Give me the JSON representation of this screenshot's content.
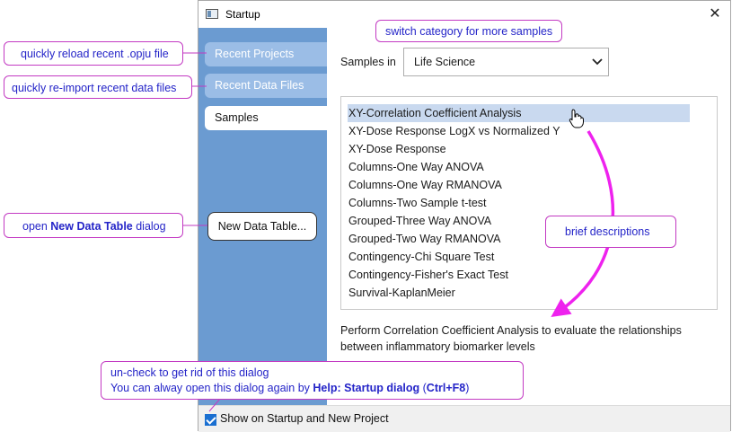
{
  "window": {
    "title": "Startup",
    "close_glyph": "✕"
  },
  "sidebar": {
    "items": [
      {
        "label": "Recent Projects"
      },
      {
        "label": "Recent Data Files"
      },
      {
        "label": "Samples"
      }
    ],
    "new_table_button": "New Data Table..."
  },
  "main": {
    "samples_label": "Samples in",
    "category_selected": "Life Science",
    "list": [
      "XY-Correlation Coefficient Analysis",
      "XY-Dose Response LogX vs Normalized Y",
      "XY-Dose Response",
      "Columns-One Way ANOVA",
      "Columns-One Way RMANOVA",
      "Columns-Two Sample t-test",
      "Grouped-Three Way ANOVA",
      "Grouped-Two Way RMANOVA",
      "Contingency-Chi Square Test",
      "Contingency-Fisher's Exact Test",
      "Survival-KaplanMeier"
    ],
    "description_line1": "Perform Correlation Coefficient Analysis to evaluate the relationships",
    "description_line2": "between inflammatory biomarker levels"
  },
  "footer": {
    "checkbox_label": "Show on Startup and New Project",
    "checked": true
  },
  "callouts": {
    "switch_category": "switch category for more samples",
    "reload_recent": "quickly reload recent .opju file",
    "reimport": "quickly re-import recent data files",
    "open_prefix": "open ",
    "open_bold": "New Data Table",
    "open_suffix": " dialog",
    "brief": "brief descriptions",
    "uncheck_line1": "un-check to get rid of this dialog",
    "uncheck_line2_prefix": "You can alway open this dialog again by ",
    "uncheck_line2_bold": "Help: Startup dialog",
    "uncheck_line2_mid": " (",
    "uncheck_line2_bold2": "Ctrl+F8",
    "uncheck_line2_suffix": ")"
  },
  "colors": {
    "sidebar": "#6b9bd1",
    "callout_border": "#c33ac3",
    "callout_text": "#2424c8",
    "arrow": "#ee22ee"
  },
  "icons": [
    "app-window-icon",
    "close-icon",
    "chevron-down-icon",
    "hand-cursor-icon",
    "checkbox-checked-icon"
  ]
}
